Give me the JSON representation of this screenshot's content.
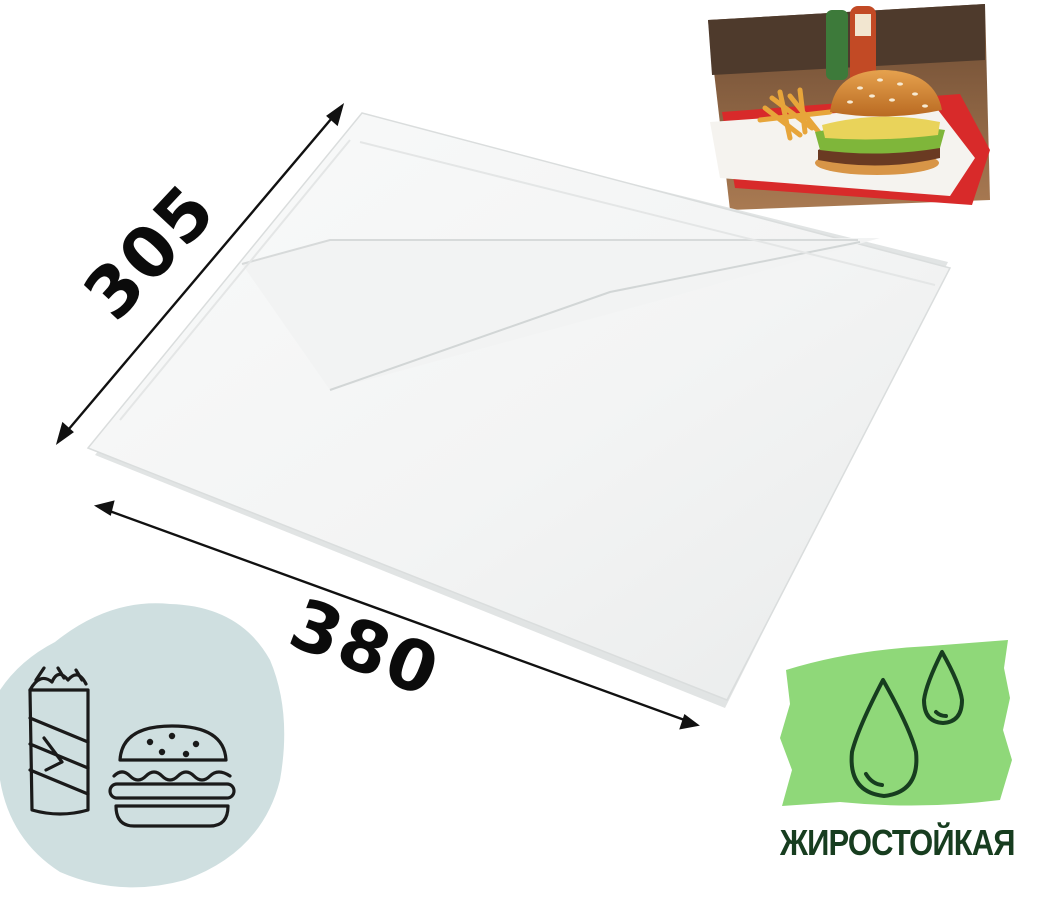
{
  "dimensions": {
    "width_label": "380",
    "height_label": "305"
  },
  "badge": {
    "label": "ЖИРОСТОЙКАЯ",
    "icon": "water-drops-icon"
  },
  "use_icons": [
    "shawarma-icon",
    "burger-icon"
  ],
  "colors": {
    "paper": "#f7f8f8",
    "badge_green": "#8fd879",
    "badge_text": "#173d1f",
    "circle": "#cfdfe0",
    "arrow": "#111111",
    "tray_red": "#d82a2a"
  }
}
